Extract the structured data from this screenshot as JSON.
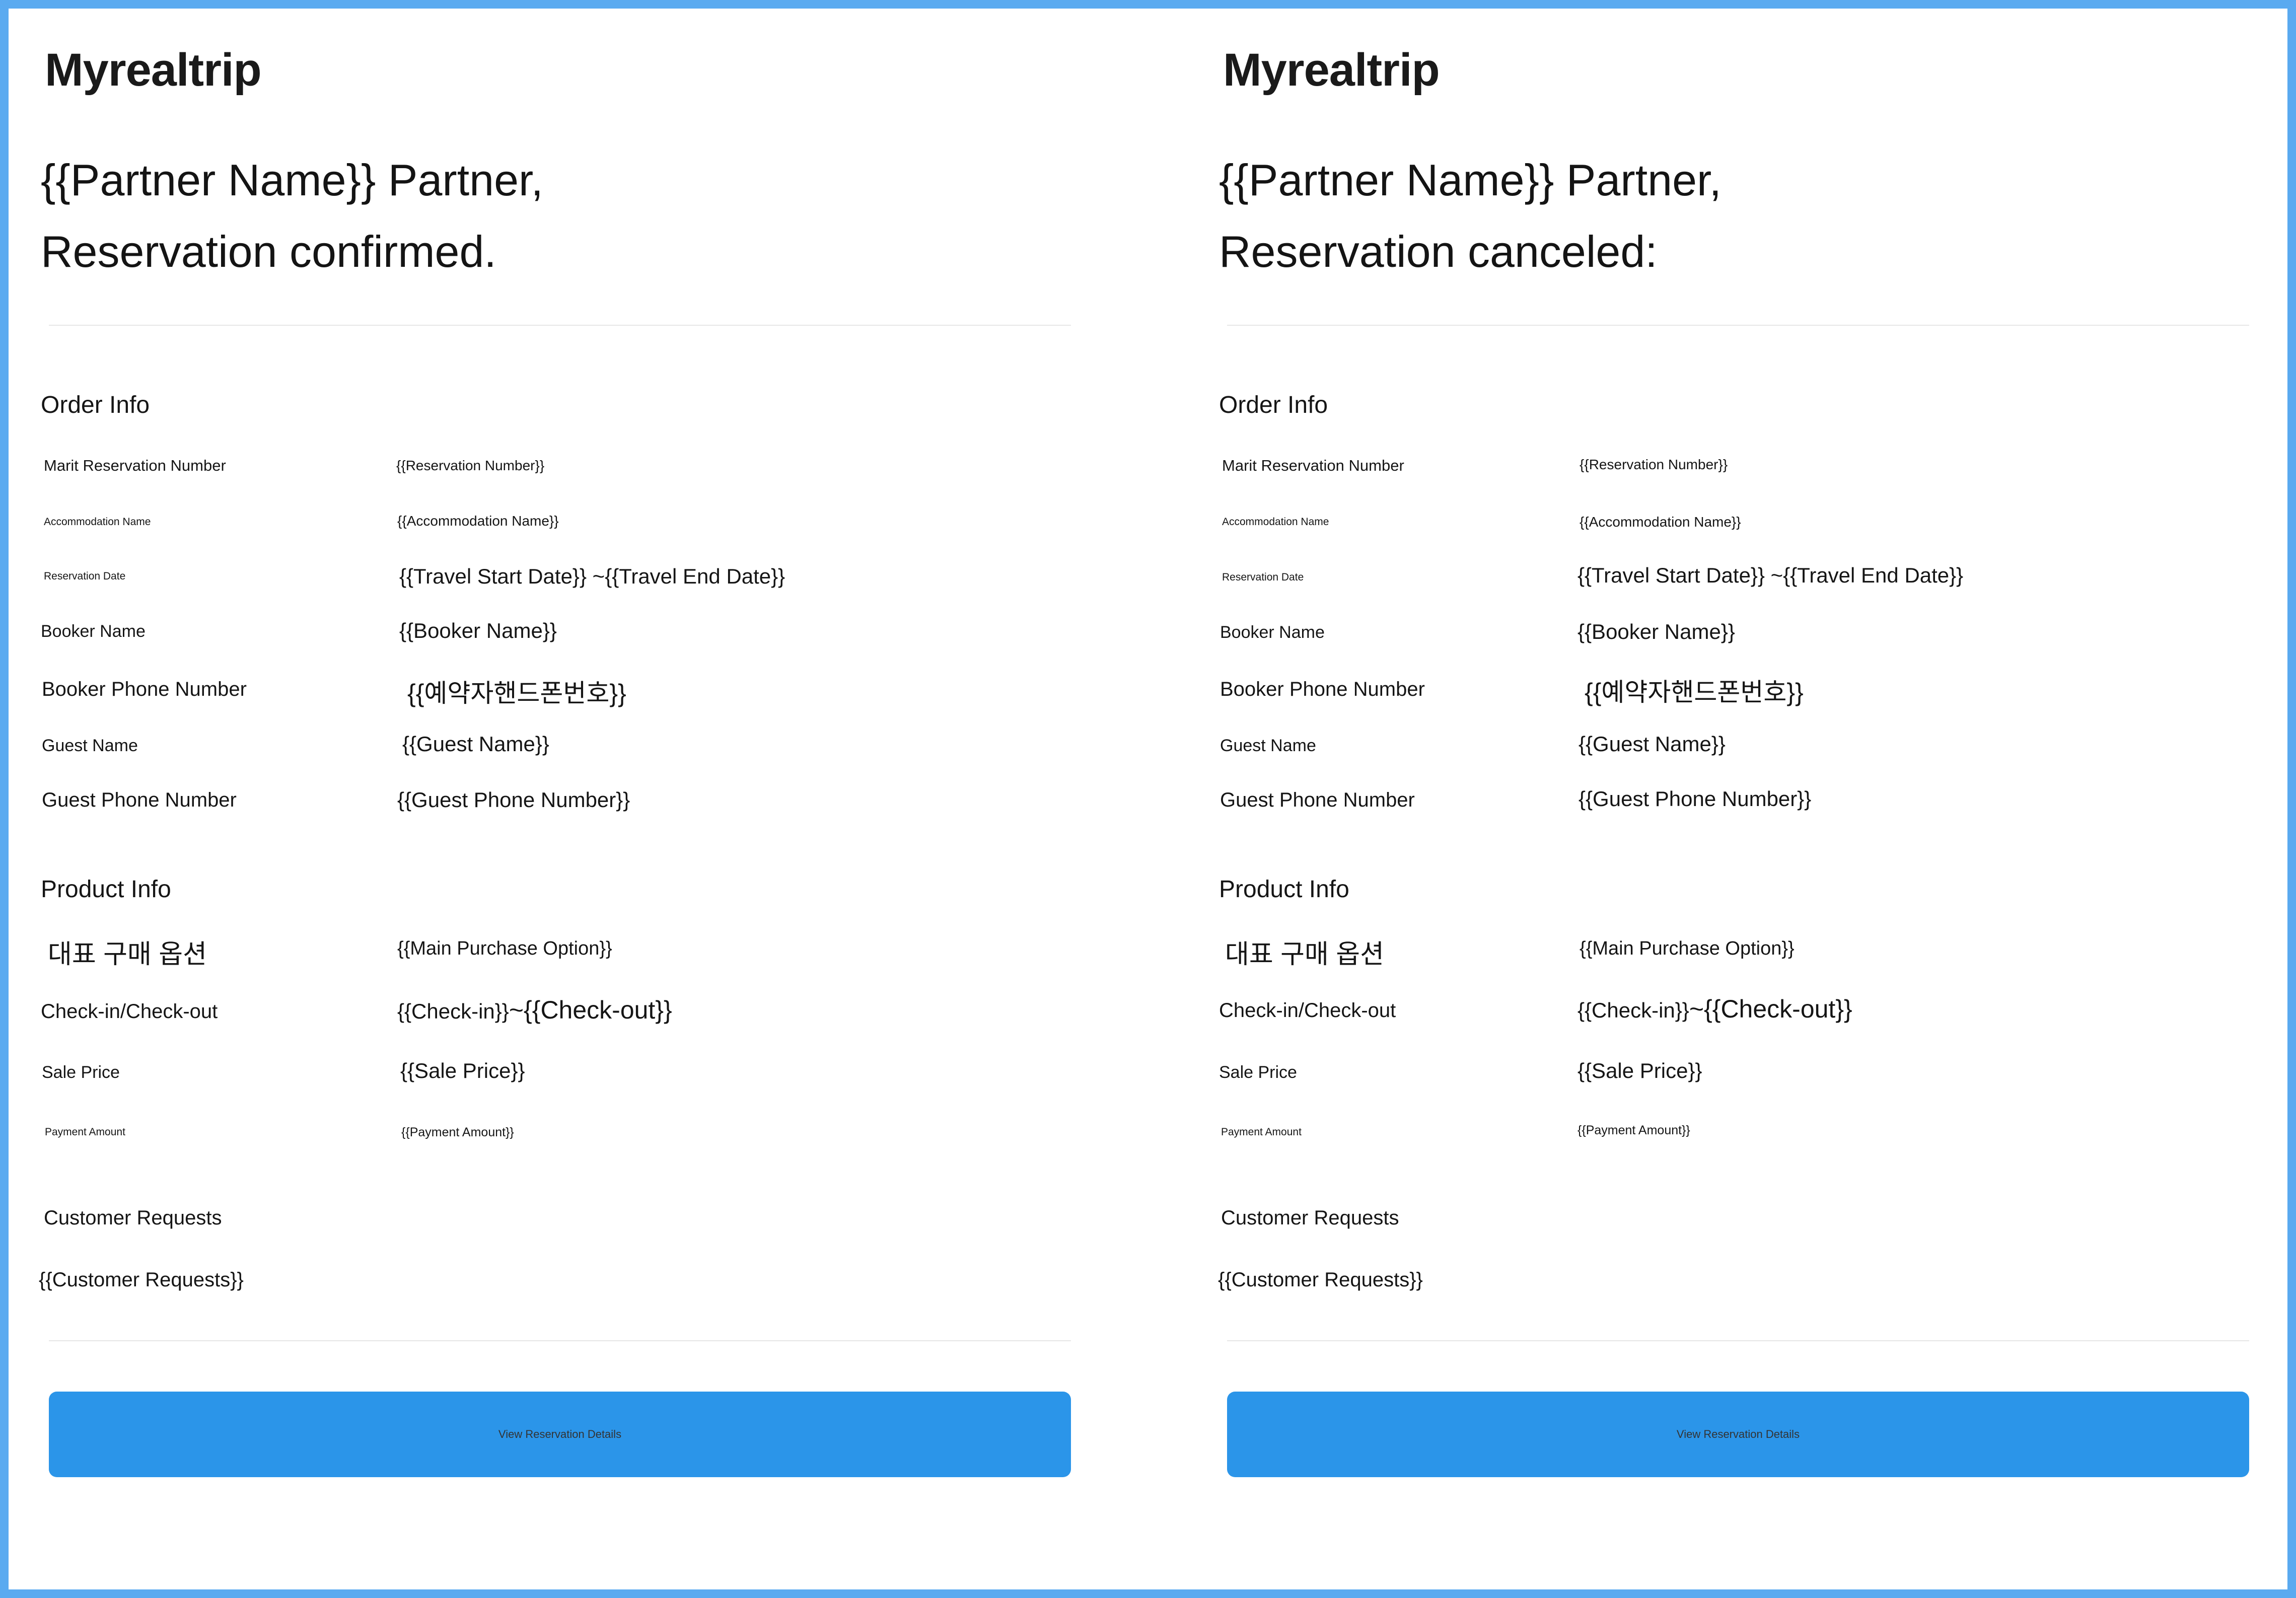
{
  "brand": {
    "logo_text": "Myrealtrip"
  },
  "labels": {
    "order_info": "Order Info",
    "reservation_number": "Marit Reservation Number",
    "accommodation_name": "Accommodation Name",
    "reservation_date": "Reservation Date",
    "booker_name": "Booker Name",
    "booker_phone": "Booker Phone Number",
    "guest_name": "Guest Name",
    "guest_phone": "Guest Phone Number",
    "product_info": "Product Info",
    "main_option": "대표 구매 옵션",
    "checkin_checkout": "Check-in/Check-out",
    "sale_price": "Sale Price",
    "payment_amount": "Payment Amount",
    "customer_requests": "Customer Requests"
  },
  "values": {
    "reservation_number": "{{Reservation Number}}",
    "accommodation_name": "{{Accommodation Name}}",
    "reservation_date": "{{Travel Start Date}} ~{{Travel End Date}}",
    "booker_name": "{{Booker Name}}",
    "booker_phone": "{{예약자핸드폰번호}}",
    "guest_name": "{{Guest Name}}",
    "guest_phone": "{{Guest Phone Number}}",
    "main_option": "{{Main Purchase Option}}",
    "checkin": "{{Check-in}}",
    "checkout": "~{{Check-out}}",
    "sale_price": "{{Sale Price}}",
    "payment_amount": "{{Payment Amount}}",
    "customer_requests": "{{Customer Requests}}"
  },
  "confirmed": {
    "greeting_line1": "{{Partner Name}} Partner,",
    "greeting_line2": "Reservation confirmed."
  },
  "canceled": {
    "greeting_line1": "{{Partner Name}} Partner,",
    "greeting_line2": "Reservation canceled:"
  },
  "button": {
    "label": "View Reservation Details"
  },
  "colors": {
    "accent": "#2b95e9",
    "border": "#5aaaf0"
  }
}
